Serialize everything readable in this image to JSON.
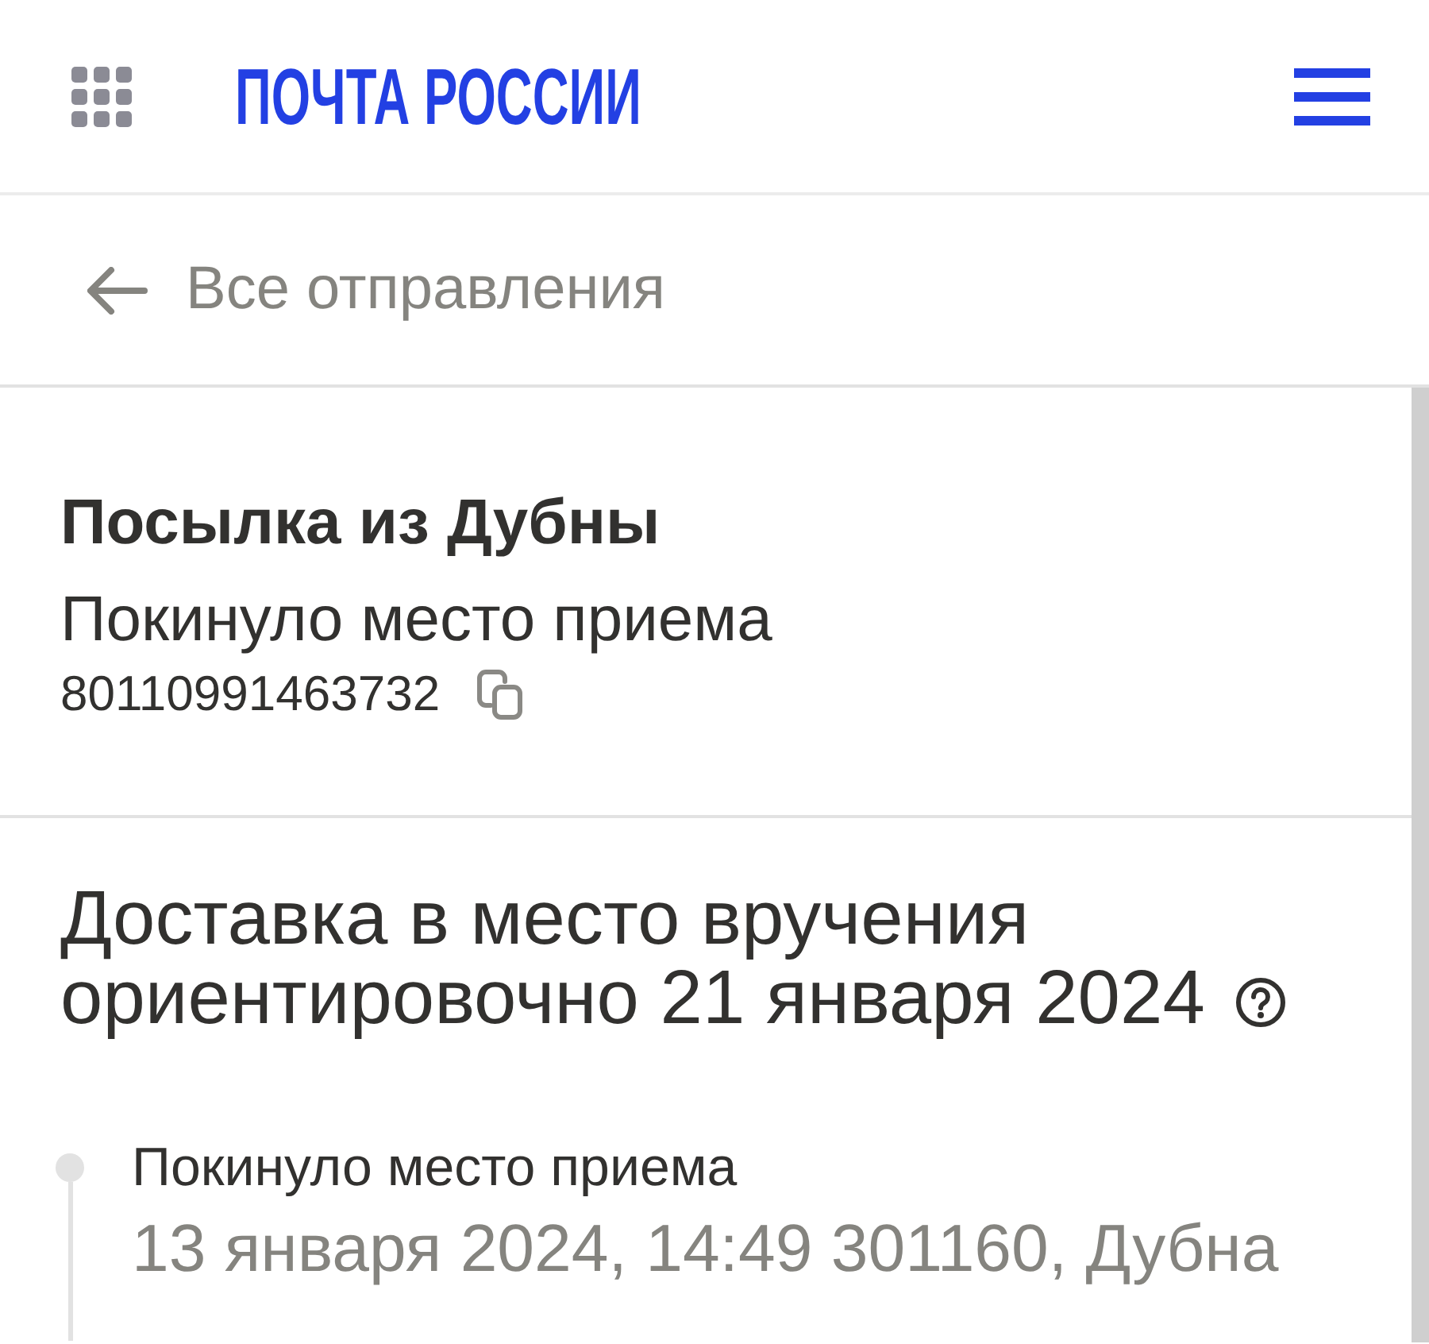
{
  "header": {
    "logo": "ПОЧТА РОССИИ"
  },
  "back_link": {
    "label": "Все отправления"
  },
  "parcel": {
    "title": "Посылка из Дубны",
    "status": "Покинуло место приема",
    "tracking_number": "80110991463732"
  },
  "delivery": {
    "estimate": "Доставка в место вручения ориентировочно 21 января 2024"
  },
  "timeline": [
    {
      "title": "Покинуло место приема",
      "details": "13 января 2024, 14:49 301160, Дубна"
    }
  ]
}
